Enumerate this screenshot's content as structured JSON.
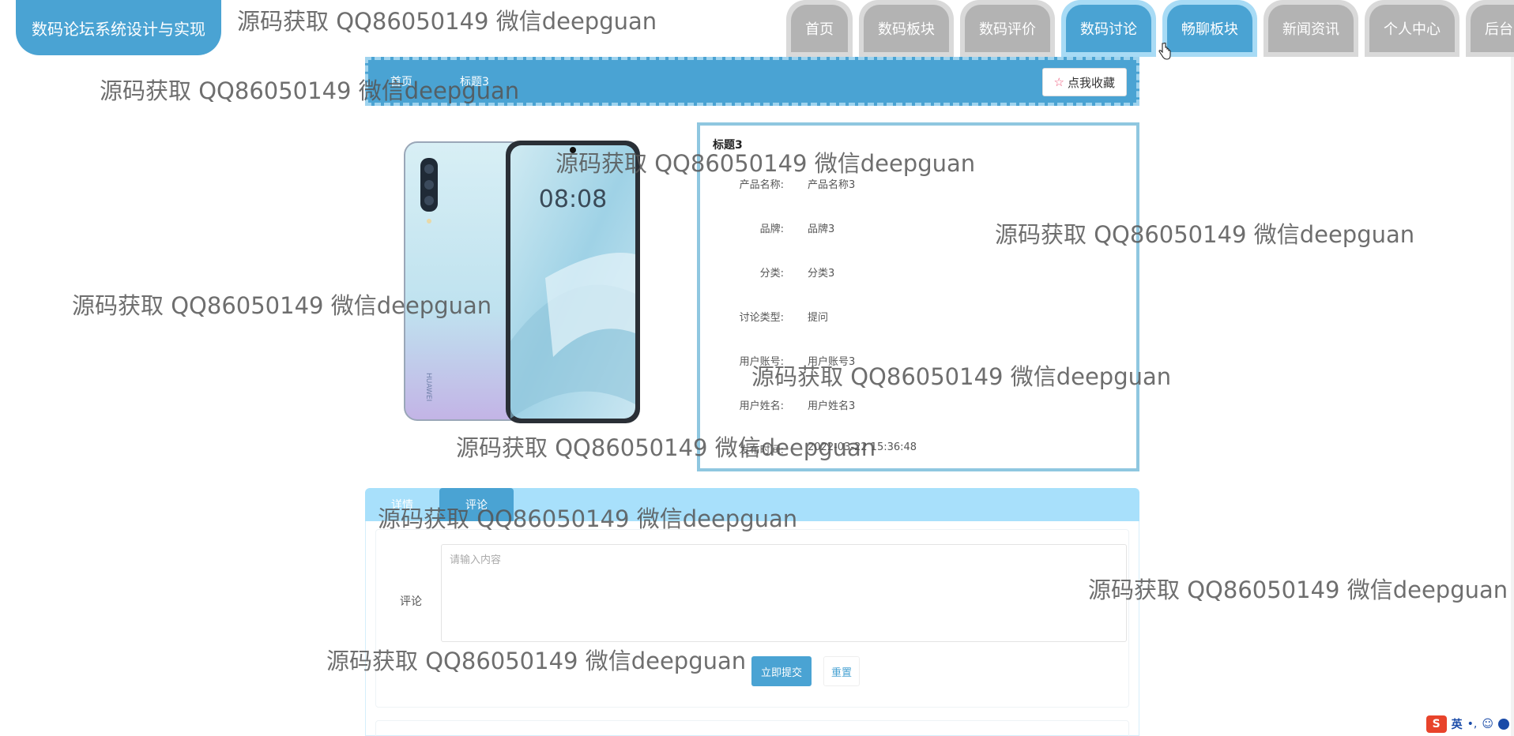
{
  "app": {
    "title": "数码论坛系统设计与实现"
  },
  "nav": {
    "items": [
      {
        "label": "首页",
        "active": false
      },
      {
        "label": "数码板块",
        "active": false
      },
      {
        "label": "数码评价",
        "active": false
      },
      {
        "label": "数码讨论",
        "active": true
      },
      {
        "label": "畅聊板块",
        "active": true
      },
      {
        "label": "新闻资讯",
        "active": false
      },
      {
        "label": "个人中心",
        "active": false
      },
      {
        "label": "后台管理",
        "active": false
      }
    ]
  },
  "breadcrumb": {
    "home": "首页",
    "current": "标题3"
  },
  "collect_button": "点我收藏",
  "detail": {
    "title": "标题3",
    "rows": [
      {
        "key": "产品名称:",
        "value": "产品名称3"
      },
      {
        "key": "品牌:",
        "value": "品牌3"
      },
      {
        "key": "分类:",
        "value": "分类3"
      },
      {
        "key": "讨论类型:",
        "value": "提问"
      },
      {
        "key": "用户账号:",
        "value": "用户账号3"
      },
      {
        "key": "用户姓名:",
        "value": "用户姓名3"
      },
      {
        "key": "发布时间:",
        "value": "2022-03-22 15:36:48"
      }
    ]
  },
  "product_image": {
    "lock_time": "08:08",
    "brand": "HUAWEI"
  },
  "tabs": [
    {
      "label": "详情",
      "active": false
    },
    {
      "label": "评论",
      "active": true
    }
  ],
  "comment_form": {
    "label": "评论",
    "placeholder": "请输入内容",
    "submit": "立即提交",
    "reset": "重置"
  },
  "watermark": "源码获取 QQ86050149 微信deepguan",
  "tray": {
    "ime": "S",
    "lang": "英",
    "dots": "•,",
    "face": "☺"
  },
  "colors": {
    "primary": "#4aa3d3",
    "light": "#a8e0fb",
    "nav_gray": "#b3b3b3"
  }
}
